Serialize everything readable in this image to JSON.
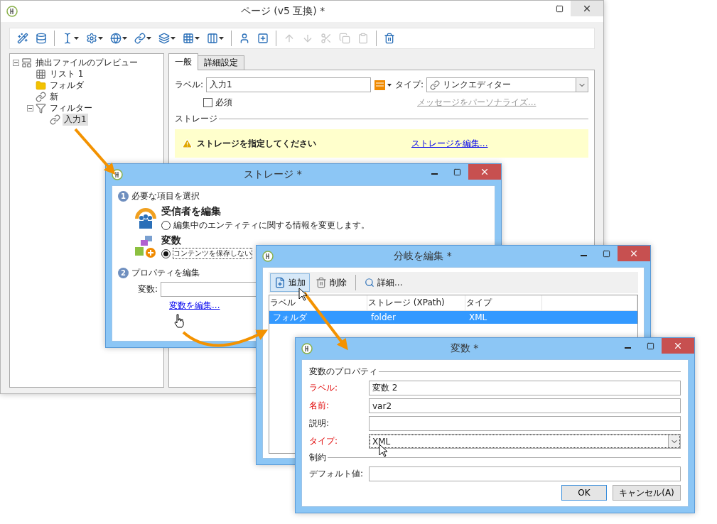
{
  "main_window": {
    "title": "ページ (v5 互換) *",
    "toolbar": [
      {
        "kind": "wand",
        "dropdown": false,
        "disabled": false
      },
      {
        "kind": "database",
        "dropdown": false,
        "disabled": false
      },
      {
        "kind": "separator"
      },
      {
        "kind": "cursor",
        "dropdown": true,
        "disabled": false
      },
      {
        "kind": "gear",
        "dropdown": true,
        "disabled": false
      },
      {
        "kind": "globe",
        "dropdown": true,
        "disabled": false
      },
      {
        "kind": "link",
        "dropdown": true,
        "disabled": false
      },
      {
        "kind": "layers",
        "dropdown": true,
        "disabled": false
      },
      {
        "kind": "grid",
        "dropdown": true,
        "disabled": false
      },
      {
        "kind": "columns",
        "dropdown": true,
        "disabled": false
      },
      {
        "kind": "separator"
      },
      {
        "kind": "person",
        "dropdown": false,
        "disabled": false
      },
      {
        "kind": "add",
        "dropdown": false,
        "disabled": false
      },
      {
        "kind": "separator"
      },
      {
        "kind": "up",
        "dropdown": false,
        "disabled": true
      },
      {
        "kind": "down",
        "dropdown": false,
        "disabled": true
      },
      {
        "kind": "cut",
        "dropdown": false,
        "disabled": true
      },
      {
        "kind": "copy",
        "dropdown": false,
        "disabled": true
      },
      {
        "kind": "paste",
        "dropdown": false,
        "disabled": true
      },
      {
        "kind": "separator"
      },
      {
        "kind": "trash",
        "dropdown": false,
        "disabled": false
      }
    ],
    "tree": [
      {
        "label": "抽出ファイルのプレビュー",
        "kind": "preview",
        "expanded": true,
        "selected": false,
        "children": [
          {
            "label": "リスト 1",
            "kind": "grid",
            "selected": false
          },
          {
            "label": "フォルダ",
            "kind": "folder",
            "selected": false
          },
          {
            "label": "新",
            "kind": "link",
            "selected": false
          },
          {
            "label": "フィルター",
            "kind": "filter",
            "expanded": true,
            "selected": false,
            "children": [
              {
                "label": "入力1",
                "kind": "link",
                "selected": true
              }
            ]
          }
        ]
      }
    ],
    "tabs": [
      {
        "label": "一般",
        "selected": true
      },
      {
        "label": "詳細設定",
        "selected": false
      }
    ],
    "label_field": {
      "label": "ラベル:",
      "value": "入力1"
    },
    "type_field": {
      "label": "タイプ:",
      "value": "リンクエディター"
    },
    "required_checkbox": {
      "label": "必須",
      "checked": false
    },
    "personalize_link": {
      "label": "メッセージをパーソナライズ...",
      "disabled": true
    },
    "storage_section": {
      "title": "ストレージ",
      "warning": "ストレージを指定してください",
      "link": "ストレージを編集..."
    }
  },
  "storage_window": {
    "title": "ストレージ *",
    "step_1": {
      "number": "1",
      "title": "必要な項目を選択",
      "options": [
        {
          "kind": "recipients",
          "title": "受信者を編集",
          "description": "編集中のエンティティに関する情報を変更します。",
          "selected": false
        },
        {
          "kind": "variable",
          "title": "変数",
          "description": "コンテンツを保存しない",
          "selected": true
        }
      ]
    },
    "step_2": {
      "number": "2",
      "title": "プロパティを編集",
      "field_label": "変数:",
      "link": "変数を編集..."
    }
  },
  "branch_window": {
    "title": "分岐を編集 *",
    "toolbar": [
      {
        "kind": "add",
        "label": "追加",
        "highlighted": true
      },
      {
        "kind": "delete",
        "label": "削除",
        "highlighted": false
      },
      {
        "kind": "separator"
      },
      {
        "kind": "details",
        "label": "詳細...",
        "highlighted": false
      }
    ],
    "columns": [
      "ラベル",
      "ストレージ (XPath)",
      "タイプ"
    ],
    "rows": [
      {
        "cells": [
          "フォルダ",
          "folder",
          "XML"
        ],
        "selected": true
      }
    ]
  },
  "variable_window": {
    "title": "変数 *",
    "sections": [
      {
        "title": "変数のプロパティ",
        "fields": [
          {
            "kind": "text",
            "label": "ラベル:",
            "value": "変数 2",
            "required": true
          },
          {
            "kind": "text",
            "label": "名前:",
            "value": "var2",
            "required": true
          },
          {
            "kind": "text",
            "label": "説明:",
            "required": false
          },
          {
            "kind": "select",
            "label": "タイプ:",
            "value": "XML",
            "required": true
          }
        ]
      },
      {
        "title": "制約",
        "fields": [
          {
            "kind": "text",
            "label": "デフォルト値:",
            "required": false
          }
        ]
      }
    ],
    "buttons": [
      {
        "label": "OK",
        "default": true
      },
      {
        "label": "キャンセル(A)",
        "default": false
      }
    ]
  }
}
